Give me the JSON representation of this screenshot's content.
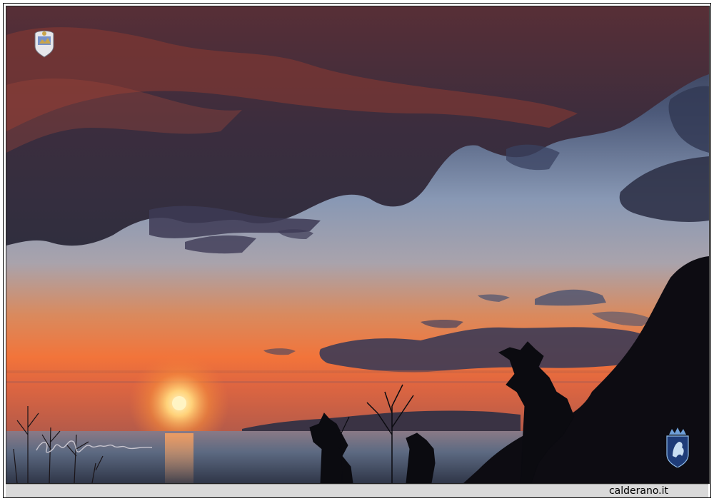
{
  "photo": {
    "subject": "sunset",
    "logo_icon": "town-emblem-icon",
    "crest_icon": "lion-shield-crest-icon",
    "signature_icon": "photographer-signature-icon"
  },
  "footer": {
    "site_label": "calderano.it"
  },
  "colors": {
    "sky_top": "#2a2f48",
    "sky_mid": "#7a8fb0",
    "horizon_orange": "#f07a3a",
    "sun": "#ffe3a0",
    "sea": "#5d6a82",
    "silhouette": "#0b0b10"
  }
}
